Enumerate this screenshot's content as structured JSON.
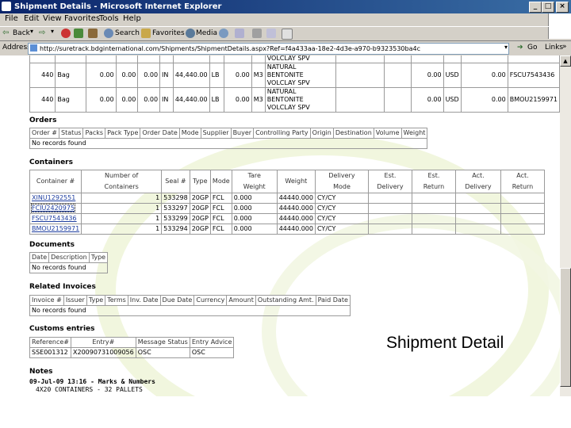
{
  "window": {
    "title": "Shipment Details - Microsoft Internet Explorer",
    "controls": [
      "_",
      "□",
      "×"
    ]
  },
  "menu": [
    "File",
    "Edit",
    "View",
    "Favorites",
    "Tools",
    "Help"
  ],
  "toolbar": {
    "back": "Back",
    "search": "Search",
    "favorites": "Favorites",
    "media": "Media"
  },
  "address": {
    "label": "Address",
    "url": "http://suretrack.bdginternational.com/Shipments/ShipmentDetails.aspx?Ref=f4a433aa-18e2-4d3e-a970-b9323530ba4c",
    "go": "Go",
    "links": "Links"
  },
  "line_items": {
    "partial_top": "VOLCLAY SPV",
    "rows": [
      {
        "qty": "440",
        "unit": "Bag",
        "c1": "0.00",
        "c2": "0.00",
        "c3": "0.00",
        "io": "IN",
        "weight": "44,440.00",
        "wunit": "LB",
        "vol": "0.00",
        "vunit": "M3",
        "desc1": "NATURAL",
        "desc2": "BENTONITE",
        "desc3": "VOLCLAY SPV",
        "value": "0.00",
        "cur": "USD",
        "amt": "0.00",
        "container": "FSCU7543436"
      },
      {
        "qty": "440",
        "unit": "Bag",
        "c1": "0.00",
        "c2": "0.00",
        "c3": "0.00",
        "io": "IN",
        "weight": "44,440.00",
        "wunit": "LB",
        "vol": "0.00",
        "vunit": "M3",
        "desc1": "NATURAL",
        "desc2": "BENTONITE",
        "desc3": "VOLCLAY SPV",
        "value": "0.00",
        "cur": "USD",
        "amt": "0.00",
        "container": "BMOU2159971"
      }
    ]
  },
  "orders": {
    "title": "Orders",
    "headers": [
      "Order #",
      "Status",
      "Packs",
      "Pack Type",
      "Order Date",
      "Mode",
      "Supplier",
      "Buyer",
      "Controlling Party",
      "Origin",
      "Destination",
      "Volume",
      "Weight"
    ],
    "empty": "No records found"
  },
  "containers": {
    "title": "Containers",
    "headers": [
      [
        "Container #",
        ""
      ],
      [
        "Number of",
        "Containers"
      ],
      [
        "Seal #",
        ""
      ],
      [
        "Type",
        ""
      ],
      [
        "Mode",
        ""
      ],
      [
        "Tare",
        "Weight"
      ],
      [
        "Weight",
        ""
      ],
      [
        "Delivery",
        "Mode"
      ],
      [
        "Est.",
        "Delivery"
      ],
      [
        "Est.",
        "Return"
      ],
      [
        "Act.",
        "Delivery"
      ],
      [
        "Act.",
        "Return"
      ]
    ],
    "rows": [
      {
        "id": "XINU1292551",
        "count": "1",
        "seal": "533298",
        "type": "20GP",
        "mode": "FCL",
        "tare": "0.000",
        "weight": "44440.000",
        "delivery": "CY/CY"
      },
      {
        "id": "FCIU2420975",
        "count": "1",
        "seal": "533297",
        "type": "20GP",
        "mode": "FCL",
        "tare": "0.000",
        "weight": "44440.000",
        "delivery": "CY/CY"
      },
      {
        "id": "FSCU7543436",
        "count": "1",
        "seal": "533299",
        "type": "20GP",
        "mode": "FCL",
        "tare": "0.000",
        "weight": "44440.000",
        "delivery": "CY/CY"
      },
      {
        "id": "BMOU2159971",
        "count": "1",
        "seal": "533294",
        "type": "20GP",
        "mode": "FCL",
        "tare": "0.000",
        "weight": "44440.000",
        "delivery": "CY/CY"
      }
    ]
  },
  "documents": {
    "title": "Documents",
    "headers": [
      "Date",
      "Description",
      "Type"
    ],
    "empty": "No records found"
  },
  "invoices": {
    "title": "Related Invoices",
    "headers": [
      "Invoice #",
      "Issuer",
      "Type",
      "Terms",
      "Inv. Date",
      "Due Date",
      "Currency",
      "Amount",
      "Outstanding Amt.",
      "Paid Date"
    ],
    "empty": "No records found"
  },
  "customs": {
    "title": "Customs entries",
    "headers": [
      "Reference#",
      "Entry#",
      "Message Status",
      "Entry Advice"
    ],
    "row": {
      "ref": "SSE001312",
      "entry": "X20090731009056",
      "status": "OSC",
      "advice": "OSC"
    }
  },
  "notes": {
    "title": "Notes",
    "line1": "09-Jul-09 13:16 - Marks & Numbers",
    "line2": "4X20 CONTAINERS - 32 PALLETS"
  },
  "caption": "Shipment Detail"
}
